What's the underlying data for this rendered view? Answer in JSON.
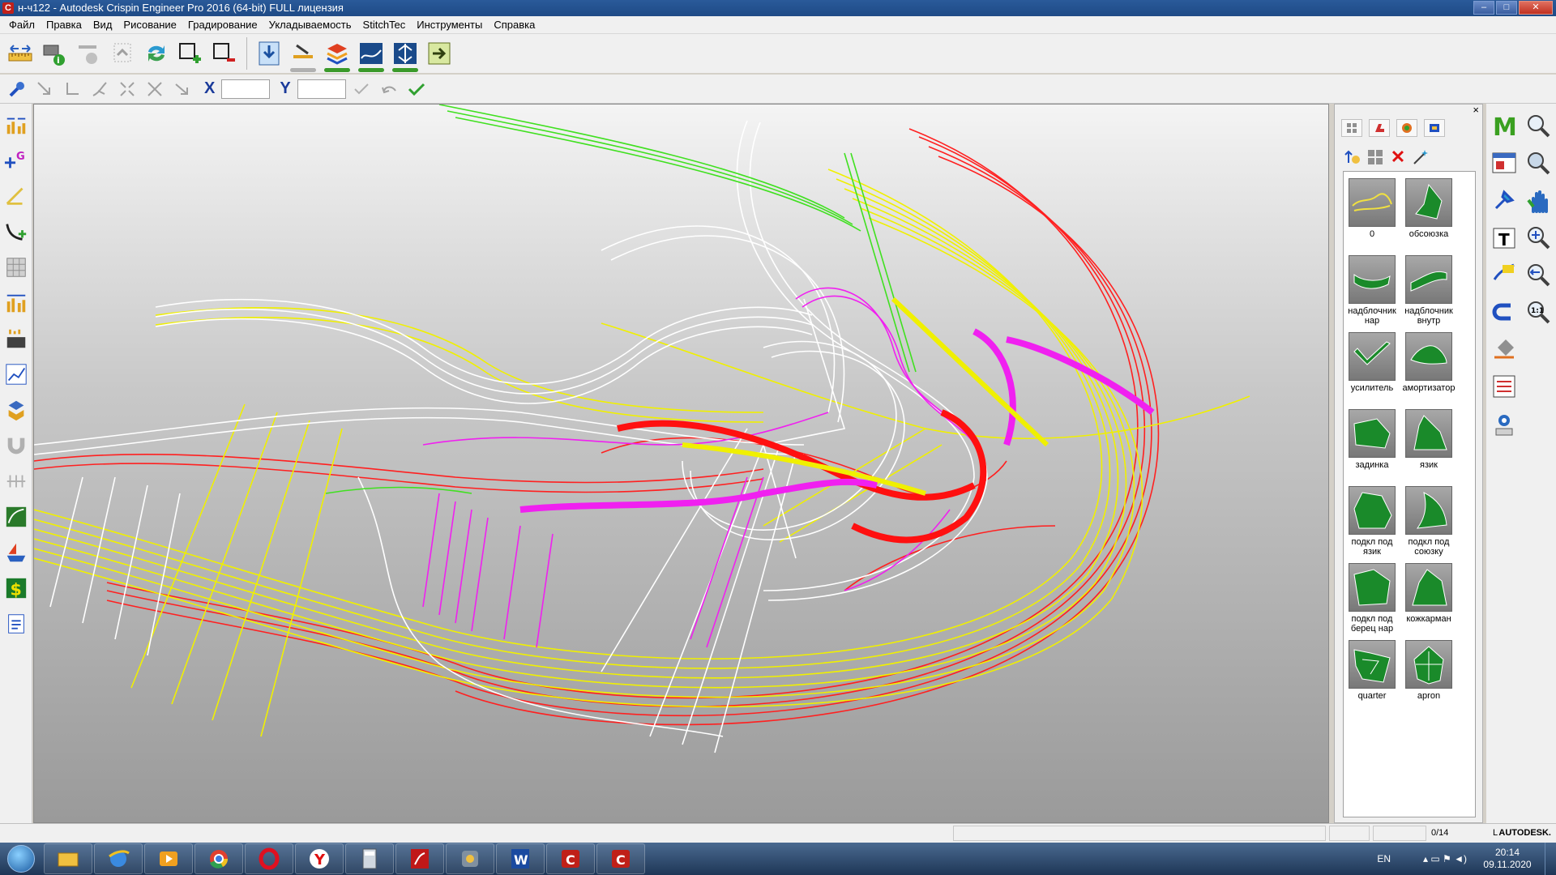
{
  "window": {
    "title": "н-ч122 - Autodesk Crispin Engineer Pro 2016 (64-bit) FULL лицензия",
    "app_icon_letter": "C",
    "minimize": "–",
    "maximize": "□",
    "close": "✕"
  },
  "menu": [
    "Файл",
    "Правка",
    "Вид",
    "Рисование",
    "Градирование",
    "Укладываемость",
    "StitchTec",
    "Инструменты",
    "Справка"
  ],
  "coords": {
    "x_label": "X",
    "y_label": "Y",
    "x_value": "",
    "y_value": ""
  },
  "panel": {
    "close_label": "×",
    "delete_label": "✕",
    "items": [
      {
        "label": "0",
        "icon": "outline-yellow-icon"
      },
      {
        "label": "обсоюзка",
        "icon": "vamp-piece-icon"
      },
      {
        "label": "надблочник нар",
        "icon": "eyestay-outer-icon"
      },
      {
        "label": "надблочник внутр",
        "icon": "eyestay-inner-icon"
      },
      {
        "label": "усилитель",
        "icon": "reinforcement-icon"
      },
      {
        "label": "амортизатор",
        "icon": "cushion-icon"
      },
      {
        "label": "задинка",
        "icon": "heel-counter-icon"
      },
      {
        "label": "язик",
        "icon": "tongue-icon"
      },
      {
        "label": "подкл под язик",
        "icon": "tongue-lining-icon"
      },
      {
        "label": "подкл под союзку",
        "icon": "vamp-lining-icon"
      },
      {
        "label": "подкл под берец нар",
        "icon": "quarter-lining-icon"
      },
      {
        "label": "кожкарман",
        "icon": "leather-pocket-icon"
      },
      {
        "label": "quarter",
        "icon": "quarter-icon"
      },
      {
        "label": "apron",
        "icon": "apron-icon"
      }
    ]
  },
  "status": {
    "count": "0/14",
    "edge_letter": "L",
    "brand": "AUTODESK."
  },
  "tray": {
    "lang": "EN",
    "time": "20:14",
    "date": "09.11.2020"
  },
  "colors": {
    "accent_green": "#3a9a2a",
    "title_blue": "#1e4a86",
    "pattern_white": "#ffffff",
    "pattern_yellow": "#f0f000",
    "pattern_red": "#e02020",
    "pattern_magenta": "#f020f0",
    "pattern_green": "#40e020"
  }
}
